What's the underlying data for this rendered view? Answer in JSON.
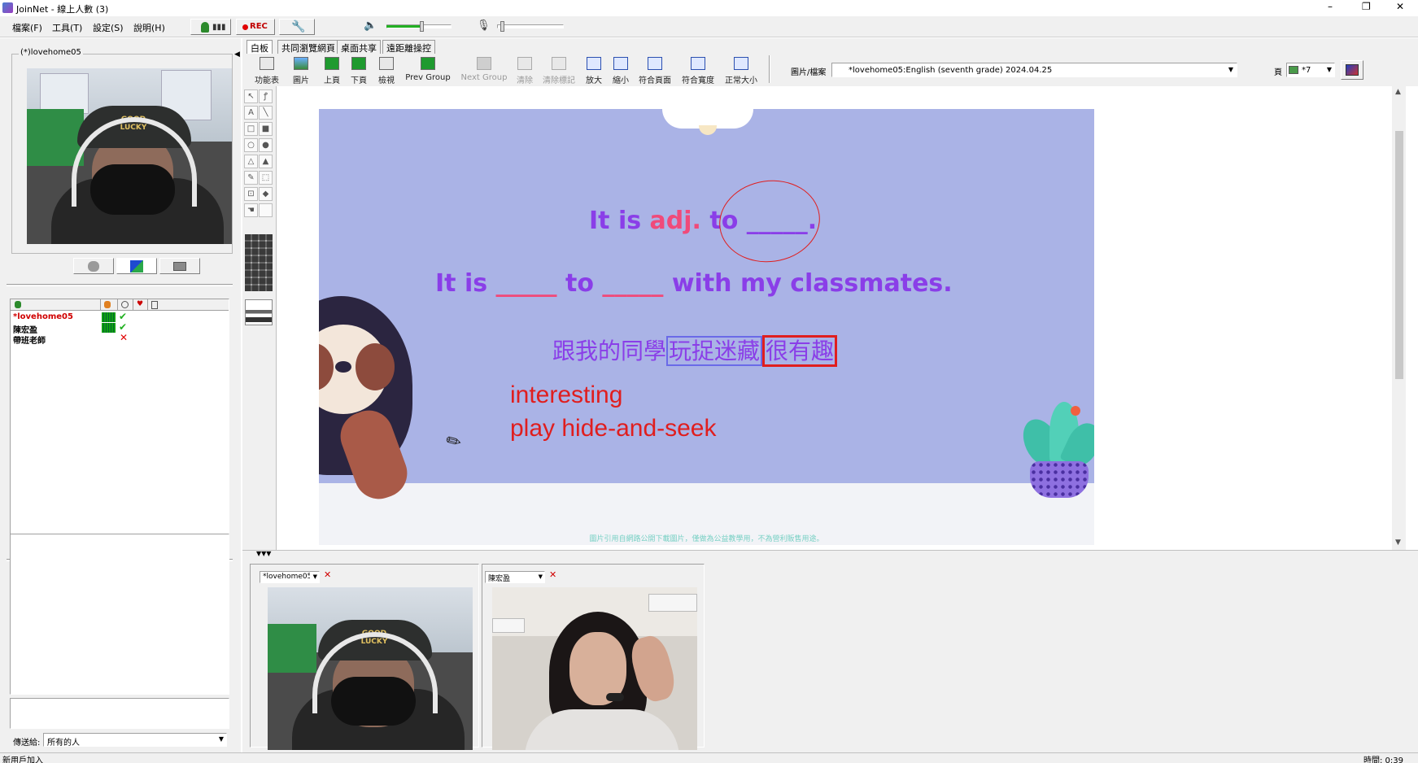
{
  "window": {
    "title": "JoinNet - 線上人數 (3)",
    "controls": [
      "–",
      "❐",
      "✕"
    ]
  },
  "menu": [
    "檔案(F)",
    "工具(T)",
    "設定(S)",
    "說明(H)"
  ],
  "topbar": {
    "rec_label": "REC",
    "volume_level": 0.55,
    "mic_level": 0.05
  },
  "left": {
    "self_video_label": "(*)lovehome05",
    "cap_text": "GOOD LUCKY",
    "participants": [
      {
        "name": "*lovehome05",
        "color": "#d00000",
        "mic": true,
        "ok": true
      },
      {
        "name": "陳宏盈",
        "color": "#000000",
        "mic": true,
        "ok": true
      },
      {
        "name": "帶班老師",
        "color": "#000000",
        "mic": false,
        "ok": false
      }
    ],
    "send_to_label": "傳送給:",
    "send_to_value": "所有的人"
  },
  "tabs": [
    "白板",
    "共同瀏覽網頁",
    "桌面共享",
    "遠距離操控"
  ],
  "toolbar": [
    {
      "label": "功能表",
      "disabled": false
    },
    {
      "label": "圖片",
      "disabled": false
    },
    {
      "label": "上頁",
      "disabled": false
    },
    {
      "label": "下頁",
      "disabled": false
    },
    {
      "label": "檢視",
      "disabled": false
    },
    {
      "label": "Prev Group",
      "disabled": false
    },
    {
      "label": "Next Group",
      "disabled": true
    },
    {
      "label": "清除",
      "disabled": true
    },
    {
      "label": "清除標記",
      "disabled": true
    },
    {
      "label": "放大",
      "disabled": false
    },
    {
      "label": "縮小",
      "disabled": false
    },
    {
      "label": "符合頁面",
      "disabled": false
    },
    {
      "label": "符合寬度",
      "disabled": false
    },
    {
      "label": "正常大小",
      "disabled": false
    }
  ],
  "file": {
    "label": "圖片/檔案",
    "value": "*lovehome05:English (seventh grade) 2024.04.25",
    "page_label": "頁",
    "page_value": "*7"
  },
  "slide": {
    "line1_a": "It is ",
    "line1_adj": "adj.",
    "line1_b": " to _____.",
    "line2_a": "It is ",
    "line2_blank1": "_____",
    "line2_b": " to ",
    "line2_blank2": "_____",
    "line2_c": " with my classmates.",
    "chinese_a": "跟我的同學",
    "chinese_b": "玩捉迷藏",
    "chinese_c": "很有趣",
    "note1": "interesting",
    "note2": "play hide-and-seek",
    "footer": "圖片引用自網路公開下載圖片，僅做為公益教學用，不為營利販售用途。",
    "colors": {
      "bg": "#aab3e6",
      "purple": "#8a3ee8",
      "pink": "#f04a7a",
      "red": "#e01e1e",
      "floor": "#f2f3f7"
    }
  },
  "bottom_videos": [
    {
      "label": "*lovehome05"
    },
    {
      "label": "陳宏盈"
    }
  ],
  "status": {
    "left": "新用戶加入",
    "right": "時間: 0:39"
  }
}
